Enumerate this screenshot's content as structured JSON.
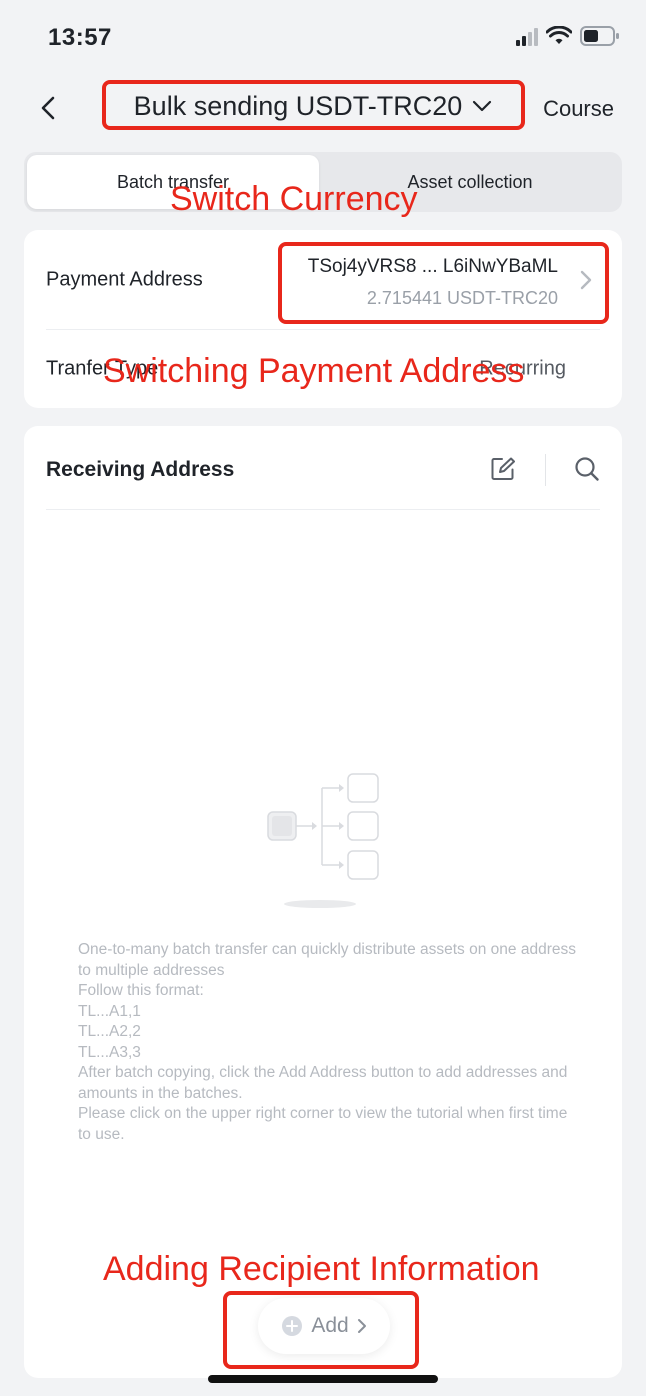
{
  "status_bar": {
    "time": "13:57"
  },
  "nav": {
    "title": "Bulk sending USDT-TRC20",
    "course_label": "Course"
  },
  "tabs": [
    {
      "label": "Batch transfer",
      "active": true
    },
    {
      "label": "Asset collection",
      "active": false
    }
  ],
  "payment": {
    "label": "Payment Address",
    "address": "TSoj4yVRS8 ... L6iNwYBaML",
    "balance": "2.715441 USDT-TRC20"
  },
  "transfer_type": {
    "label": "Tranfer Type",
    "value": "Recurring"
  },
  "receiving": {
    "title": "Receiving Address",
    "empty_text": "One-to-many batch transfer can quickly distribute assets on one address to multiple addresses\nFollow this format:\nTL...A1,1\nTL...A2,2\nTL...A3,3\n After batch copying, click the Add Address button to add addresses and amounts in the batches.\nPlease click on the upper right corner to view the tutorial when first time to use.",
    "add_label": "Add"
  },
  "annotations": {
    "switch_currency": "Switch Currency",
    "switch_payment": "Switching Payment Address",
    "add_recipient": "Adding Recipient Information",
    "color": "#e8271b"
  },
  "colors": {
    "background": "#f2f3f5",
    "card": "#ffffff",
    "muted_text": "#9aa0a8"
  }
}
